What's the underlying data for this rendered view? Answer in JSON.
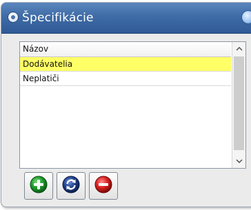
{
  "window": {
    "title": "Špecifikácie"
  },
  "list": {
    "header": "Názov",
    "rows": [
      {
        "label": "Dodávatelia",
        "selected": true
      },
      {
        "label": "Neplatiči",
        "selected": false
      }
    ]
  },
  "toolbar": {
    "buttons": [
      {
        "name": "add",
        "icon": "plus-circle-icon",
        "color": "#1f9a2e"
      },
      {
        "name": "refresh",
        "icon": "refresh-circle-icon",
        "color": "#1e3f8a"
      },
      {
        "name": "remove",
        "icon": "minus-circle-icon",
        "color": "#d81e1e"
      }
    ]
  },
  "colors": {
    "title_bar": "#3f6ba6",
    "selected_row": "#ffff66"
  }
}
